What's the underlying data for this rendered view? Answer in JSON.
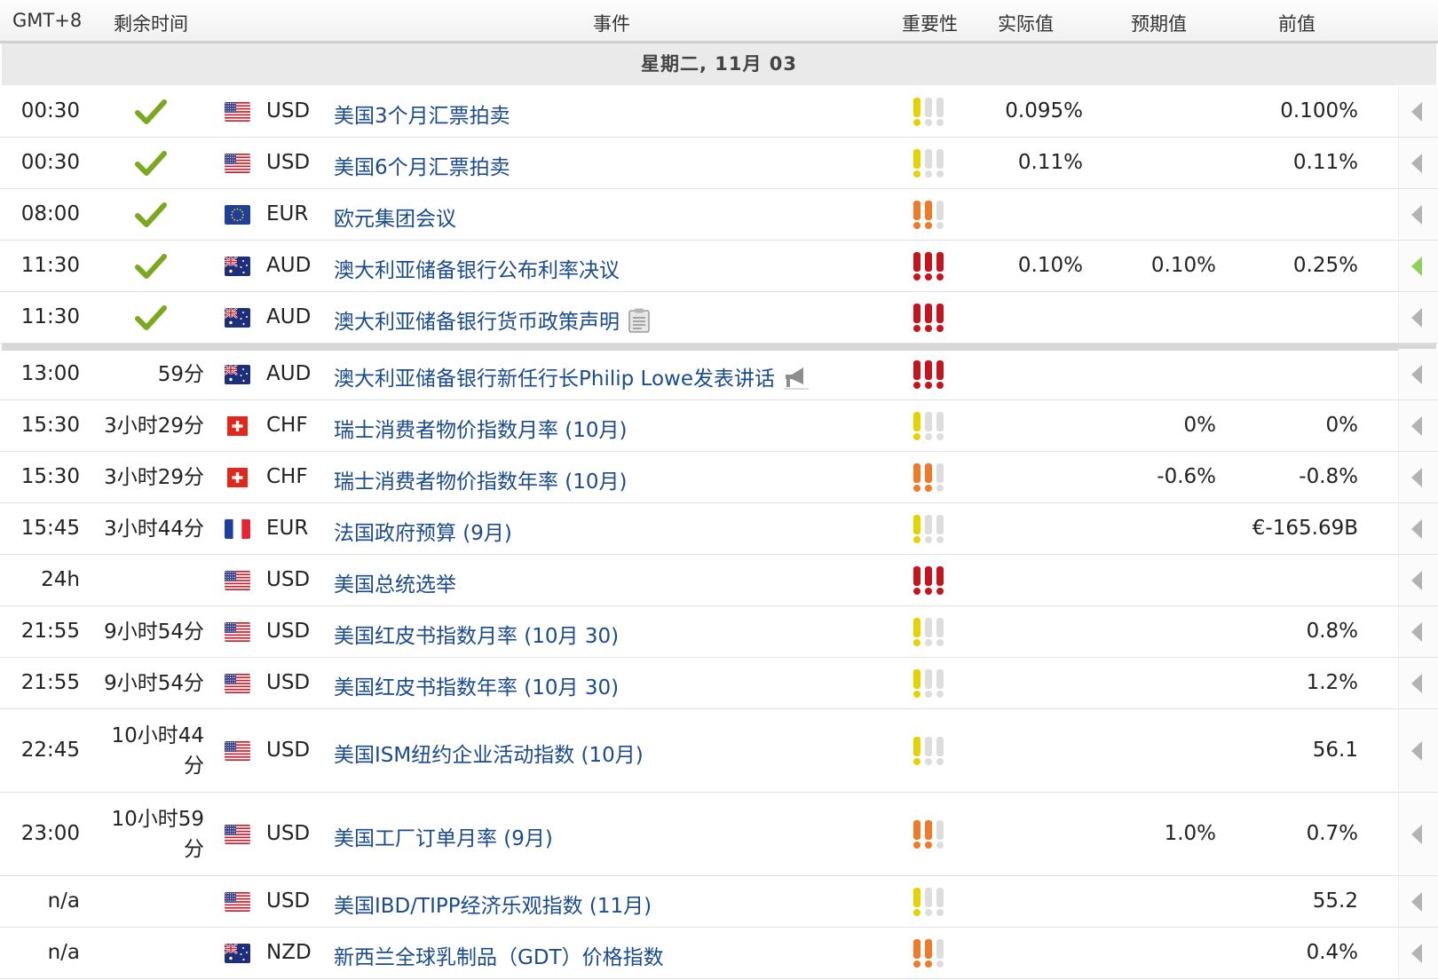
{
  "header": {
    "tz": "GMT+8",
    "remaining": "剩余时间",
    "event": "事件",
    "importance": "重要性",
    "actual": "实际值",
    "forecast": "预期值",
    "previous": "前值"
  },
  "day": "星期二, 11月 03",
  "colors": {
    "link": "#1a4b8c",
    "imp_low": "#e4d300",
    "imp_med": "#ee7a2a",
    "imp_high": "#c4141e",
    "imp_off": "#dddddd",
    "check": "#7aa81f"
  },
  "rows": [
    {
      "time": "00:30",
      "remaining": "",
      "done": true,
      "flag": "us-flag",
      "currency": "USD",
      "event": "美国3个月汇票拍卖",
      "icon": "",
      "importance": 1,
      "actual": "0.095%",
      "forecast": "",
      "previous": "0.100%",
      "arrow": "gray"
    },
    {
      "time": "00:30",
      "remaining": "",
      "done": true,
      "flag": "us-flag",
      "currency": "USD",
      "event": "美国6个月汇票拍卖",
      "icon": "",
      "importance": 1,
      "actual": "0.11%",
      "forecast": "",
      "previous": "0.11%",
      "arrow": "gray"
    },
    {
      "time": "08:00",
      "remaining": "",
      "done": true,
      "flag": "eu-flag",
      "currency": "EUR",
      "event": "欧元集团会议",
      "icon": "",
      "importance": 2,
      "actual": "",
      "forecast": "",
      "previous": "",
      "arrow": "gray"
    },
    {
      "time": "11:30",
      "remaining": "",
      "done": true,
      "flag": "au-flag",
      "currency": "AUD",
      "event": "澳大利亚储备银行公布利率决议",
      "icon": "",
      "importance": 3,
      "actual": "0.10%",
      "forecast": "0.10%",
      "previous": "0.25%",
      "arrow": "green"
    },
    {
      "time": "11:30",
      "remaining": "",
      "done": true,
      "flag": "au-flag",
      "currency": "AUD",
      "event": "澳大利亚储备银行货币政策声明",
      "icon": "document-icon",
      "importance": 3,
      "actual": "",
      "forecast": "",
      "previous": "",
      "arrow": "gray"
    },
    {
      "time": "13:00",
      "remaining": "59分",
      "done": false,
      "flag": "au-flag",
      "currency": "AUD",
      "event": "澳大利亚储备银行新任行长Philip Lowe发表讲话",
      "icon": "speaker-icon",
      "importance": 3,
      "actual": "",
      "forecast": "",
      "previous": "",
      "arrow": "gray"
    },
    {
      "time": "15:30",
      "remaining": "3小时29分",
      "done": false,
      "flag": "ch-flag",
      "currency": "CHF",
      "event": "瑞士消费者物价指数月率 (10月)",
      "icon": "",
      "importance": 1,
      "actual": "",
      "forecast": "0%",
      "previous": "0%",
      "arrow": "gray"
    },
    {
      "time": "15:30",
      "remaining": "3小时29分",
      "done": false,
      "flag": "ch-flag",
      "currency": "CHF",
      "event": "瑞士消费者物价指数年率 (10月)",
      "icon": "",
      "importance": 2,
      "actual": "",
      "forecast": "-0.6%",
      "previous": "-0.8%",
      "arrow": "gray"
    },
    {
      "time": "15:45",
      "remaining": "3小时44分",
      "done": false,
      "flag": "fr-flag",
      "currency": "EUR",
      "event": "法国政府预算 (9月)",
      "icon": "",
      "importance": 1,
      "actual": "",
      "forecast": "",
      "previous": "€-165.69B",
      "arrow": "gray"
    },
    {
      "time": "24h",
      "remaining": "",
      "done": false,
      "flag": "us-flag",
      "currency": "USD",
      "event": "美国总统选举",
      "icon": "",
      "importance": 3,
      "actual": "",
      "forecast": "",
      "previous": "",
      "arrow": "gray"
    },
    {
      "time": "21:55",
      "remaining": "9小时54分",
      "done": false,
      "flag": "us-flag",
      "currency": "USD",
      "event": "美国红皮书指数月率 (10月 30)",
      "icon": "",
      "importance": 1,
      "actual": "",
      "forecast": "",
      "previous": "0.8%",
      "arrow": "gray"
    },
    {
      "time": "21:55",
      "remaining": "9小时54分",
      "done": false,
      "flag": "us-flag",
      "currency": "USD",
      "event": "美国红皮书指数年率 (10月 30)",
      "icon": "",
      "importance": 1,
      "actual": "",
      "forecast": "",
      "previous": "1.2%",
      "arrow": "gray"
    },
    {
      "time": "22:45",
      "remaining": "10小时44分",
      "done": false,
      "flag": "us-flag",
      "currency": "USD",
      "event": "美国ISM纽约企业活动指数 (10月)",
      "icon": "",
      "importance": 1,
      "actual": "",
      "forecast": "",
      "previous": "56.1",
      "arrow": "gray"
    },
    {
      "time": "23:00",
      "remaining": "10小时59分",
      "done": false,
      "flag": "us-flag",
      "currency": "USD",
      "event": "美国工厂订单月率 (9月)",
      "icon": "",
      "importance": 2,
      "actual": "",
      "forecast": "1.0%",
      "previous": "0.7%",
      "arrow": "gray"
    },
    {
      "time": "n/a",
      "remaining": "",
      "done": false,
      "flag": "us-flag",
      "currency": "USD",
      "event": "美国IBD/TIPP经济乐观指数 (11月)",
      "icon": "",
      "importance": 1,
      "actual": "",
      "forecast": "",
      "previous": "55.2",
      "arrow": "gray"
    },
    {
      "time": "n/a",
      "remaining": "",
      "done": false,
      "flag": "au-flag",
      "currency": "NZD",
      "event": "新西兰全球乳制品（GDT）价格指数",
      "icon": "",
      "importance": 2,
      "actual": "",
      "forecast": "",
      "previous": "0.4%",
      "arrow": "gray"
    }
  ]
}
